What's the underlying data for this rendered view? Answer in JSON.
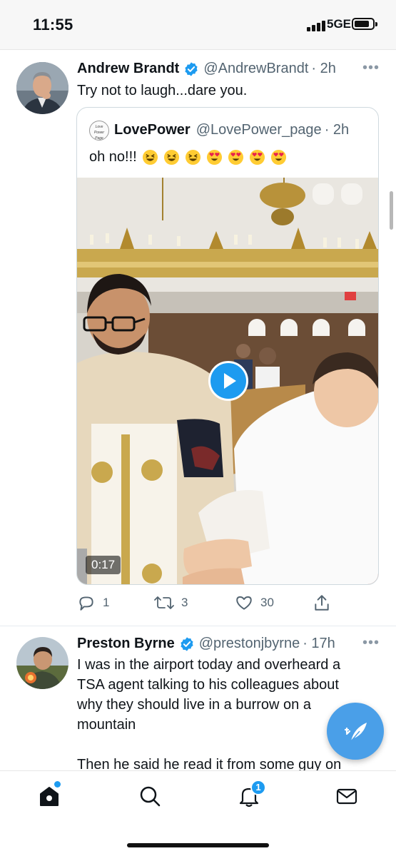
{
  "status_bar": {
    "time": "11:55",
    "network": "5GE"
  },
  "tweets": [
    {
      "name": "Andrew Brandt",
      "handle": "@AndrewBrandt",
      "time": "· 2h",
      "text": "Try not to laugh...dare you.",
      "quote": {
        "name": "LovePower",
        "handle": "@LovePower_page",
        "time": "· 2h",
        "text": "oh no!!!",
        "avatar_text": "Love Power Page",
        "emojis": [
          "grinning-squinting-face",
          "grinning-squinting-face",
          "grinning-squinting-face",
          "smiling-face-with-heart-eyes",
          "smiling-face-with-heart-eyes",
          "smiling-face-with-heart-eyes",
          "smiling-face-with-heart-eyes"
        ],
        "video_duration": "0:17"
      },
      "actions": {
        "replies": "1",
        "retweets": "3",
        "likes": "30"
      }
    },
    {
      "name": "Preston Byrne",
      "handle": "@prestonjbyrne",
      "time": "· 17h",
      "lines": [
        "I was in the airport today and overheard a",
        "TSA agent talking to his colleagues about",
        "why they should live in a burrow on a",
        "mountain",
        "Then he said he read it from some guy on"
      ]
    }
  ],
  "tab_bar": {
    "notifications_count": "1"
  },
  "colors": {
    "accent": "#1d9bf0",
    "fab": "#4a9fe8",
    "secondary_text": "#536471"
  }
}
